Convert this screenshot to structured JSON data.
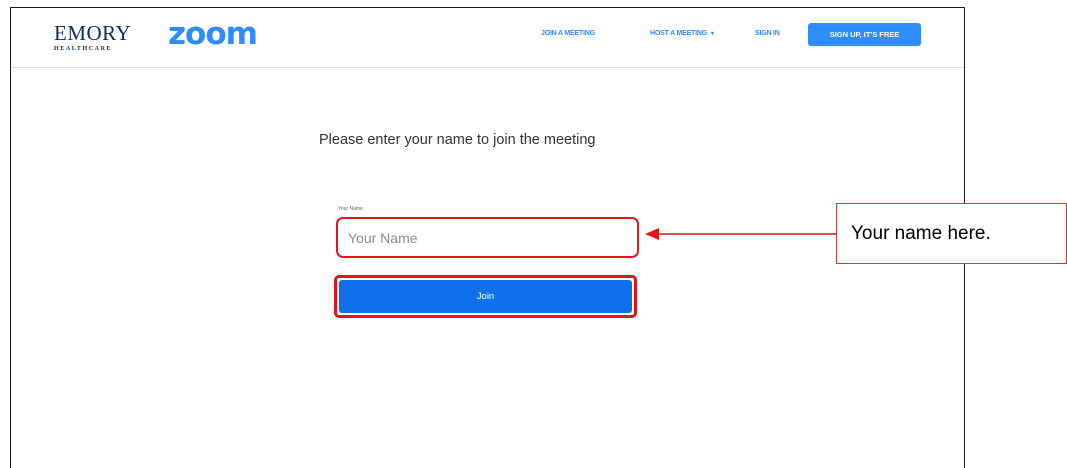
{
  "brand": {
    "emory_name": "EMORY",
    "emory_sub": "HEALTHCARE",
    "zoom_logo": "zoom",
    "zoom_color": "#2d8cff"
  },
  "nav": {
    "join_meeting": "JOIN A MEETING",
    "host_meeting": "HOST A MEETING",
    "host_caret": "▾",
    "sign_in": "SIGN IN",
    "sign_up": "SIGN UP, IT'S FREE"
  },
  "main": {
    "prompt": "Please enter your name to join the meeting",
    "field_label": "Your Name",
    "name_placeholder": "Your Name",
    "join_label": "Join"
  },
  "annotation": {
    "callout_text": "Your name here.",
    "highlight_color": "#e8121a"
  }
}
